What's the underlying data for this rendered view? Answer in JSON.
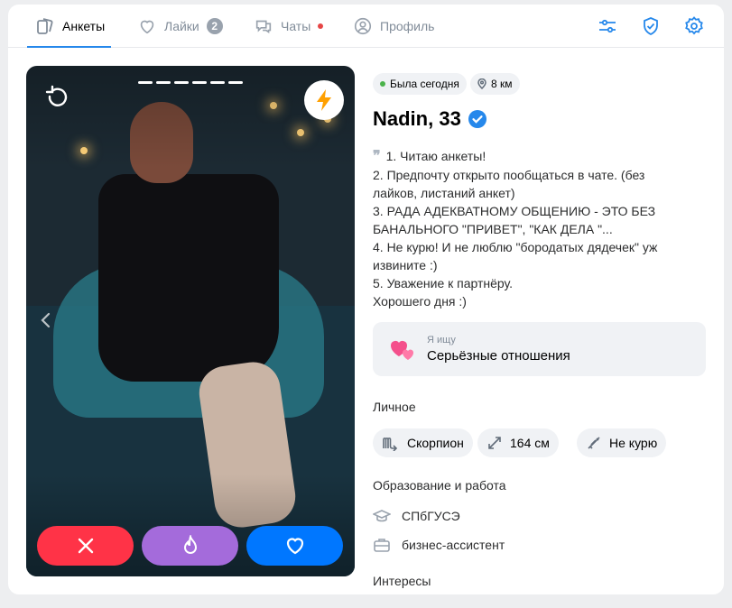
{
  "colors": {
    "accent": "#2688eb",
    "dislike": "#ff3347",
    "superlike": "#a46bdb",
    "like": "#0077ff",
    "online": "#4bb34b",
    "unread_dot": "#e64646"
  },
  "tabs": [
    {
      "label": "Анкеты",
      "icon": "cards-icon",
      "active": true
    },
    {
      "label": "Лайки",
      "icon": "heart-icon",
      "badge": "2"
    },
    {
      "label": "Чаты",
      "icon": "chats-icon",
      "unread": true
    },
    {
      "label": "Профиль",
      "icon": "profile-icon"
    }
  ],
  "toolbar": {
    "icons": [
      "filters-icon",
      "shield-check-icon",
      "gear-icon"
    ]
  },
  "photo": {
    "icons": [
      "undo-icon",
      "lightning-icon",
      "chevron-left-icon"
    ],
    "slides": 6
  },
  "actions": {
    "icons": [
      "close-icon",
      "flame-icon",
      "heart-outline-icon"
    ]
  },
  "profile": {
    "status": "Была сегодня",
    "distance": "8 км",
    "name": "Nadin, 33",
    "verified": true,
    "bio": [
      "1. Читаю анкеты!",
      "2. Предпочту открыто пообщаться в чате. (без",
      "лайков, листаний анкет)",
      "3. РАДА АДЕКВАТНОМУ ОБЩЕНИЮ - ЭТО БЕЗ",
      "БАНАЛЬНОГО \"ПРИВЕТ\", \"КАК ДЕЛА \"...",
      "4. Не курю! И не люблю \"бородатых дядечек\" уж",
      "извините :)",
      "5. Уважение к партнёру.",
      "Хорошего дня :)"
    ],
    "seeking": {
      "label": "Я ищу",
      "value": "Серьёзные отношения"
    },
    "personal": {
      "title": "Личное",
      "chips": [
        {
          "icon": "scorpio-icon",
          "label": "Скорпион"
        },
        {
          "icon": "height-icon",
          "label": "164 см"
        },
        {
          "icon": "no-smoking-icon",
          "label": "Не курю"
        }
      ]
    },
    "education": {
      "title": "Образование и работа",
      "school": "СПбГУСЭ",
      "job": "бизнес-ассистент"
    },
    "interests": {
      "title": "Интересы"
    }
  }
}
